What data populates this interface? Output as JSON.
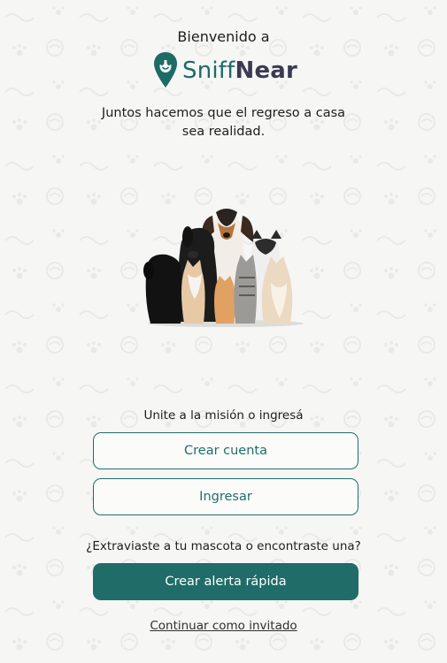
{
  "header": {
    "welcome_text": "Bienvenido a",
    "brand_part1": "Sniff",
    "brand_part2": "Near",
    "tagline": "Juntos hacemos que el regreso a casa sea realidad."
  },
  "hero": {
    "image_subject": "pets-group-dogs-and-cats"
  },
  "auth": {
    "prompt": "Unite a la misión o ingresá",
    "create_account_label": "Crear cuenta",
    "login_label": "Ingresar"
  },
  "alert": {
    "question": "¿Extraviaste a tu mascota o encontraste una?",
    "button_label": "Crear alerta rápida"
  },
  "guest": {
    "link_label": "Continuar como invitado"
  },
  "colors": {
    "primary": "#1f6c68",
    "brand_secondary": "#3a3a52",
    "background": "#f6f6f5"
  }
}
